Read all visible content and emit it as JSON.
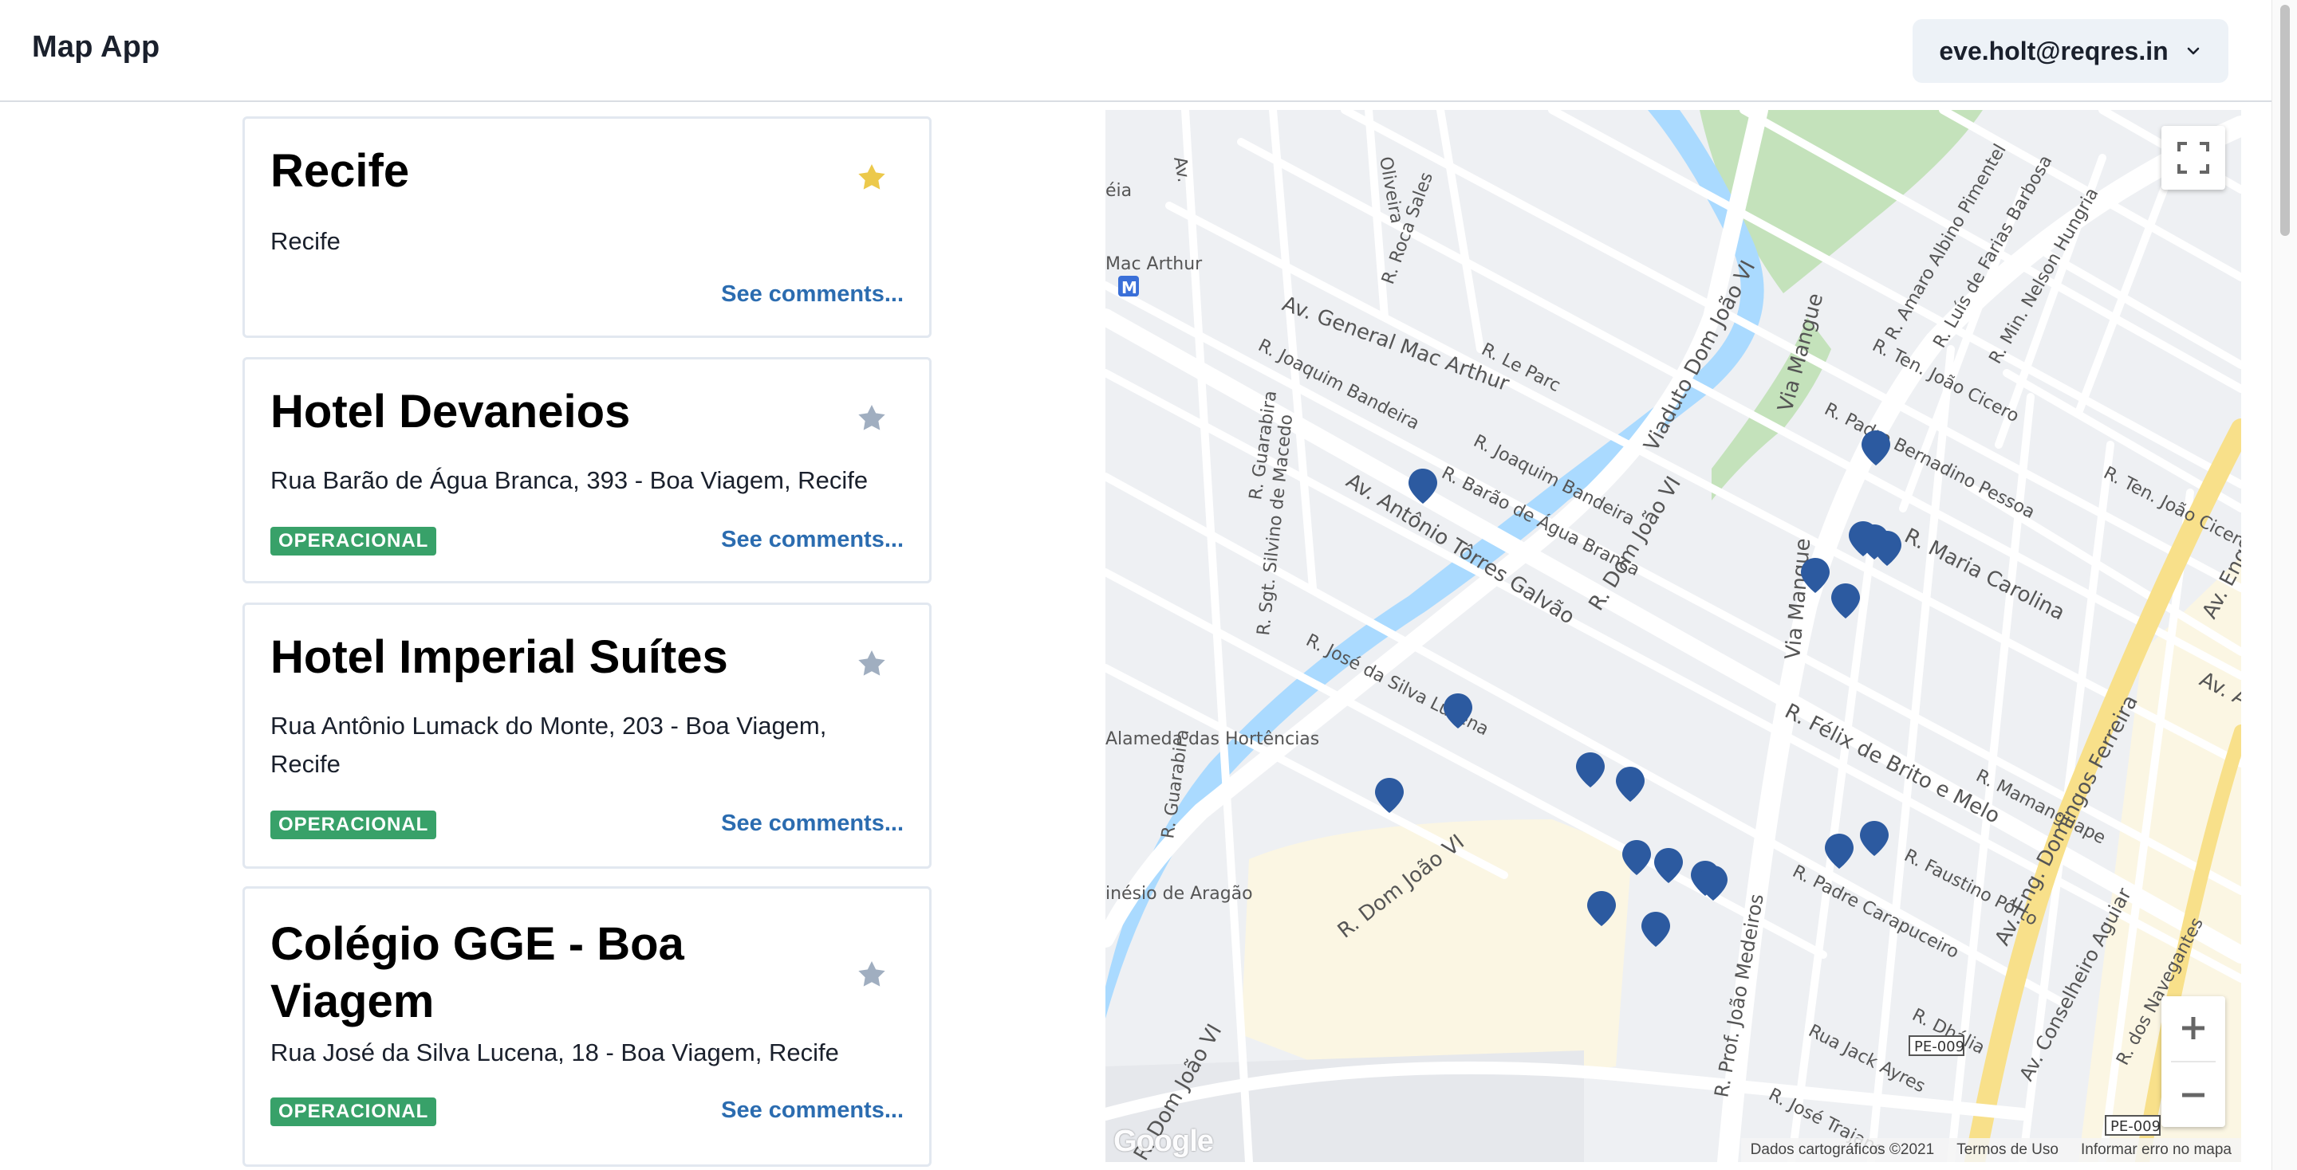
{
  "header": {
    "app_title": "Map App",
    "user_email": "eve.holt@reqres.in",
    "menu_icon": "chevron-down-icon"
  },
  "places": [
    {
      "name": "Recife",
      "address": "Recife",
      "status": "",
      "favorite": true,
      "comments_link": "See comments..."
    },
    {
      "name": "Hotel Devaneios",
      "address": "Rua Barão de Água Branca, 393 - Boa Viagem, Recife",
      "status": "OPERACIONAL",
      "favorite": false,
      "comments_link": "See comments..."
    },
    {
      "name": "Hotel Imperial Suítes",
      "address": "Rua Antônio Lumack do Monte, 203 - Boa Viagem, Recife",
      "status": "OPERACIONAL",
      "favorite": false,
      "comments_link": "See comments..."
    },
    {
      "name": "Colégio GGE - Boa Viagem",
      "address": "Rua José da Silva Lucena, 18 - Boa Viagem, Recife",
      "status": "OPERACIONAL",
      "favorite": false,
      "comments_link": "See comments..."
    }
  ],
  "colors": {
    "favorite_star": "#ECC94B",
    "inactive_star": "#A0AEC0",
    "status_badge": "#38A169",
    "link": "#2B6CB0",
    "map_pin": "#2C5AA0",
    "water": "#AADAFF",
    "park": "#C0DFB8",
    "major_road": "#F8E08A"
  },
  "map": {
    "street_labels": [
      "Mac Arthur",
      "Av. General Mac Arthur",
      "R. Joaquim Bandeira",
      "R. Joaquim Bandeira",
      "R. Barão de Água Branca",
      "Av. Antônio Tôrres Galvão",
      "R. Dom João VI",
      "R. Dom João VI",
      "R. Dom João VI",
      "Viaduto Dom João VI",
      "Via Mangue",
      "Via Mangue",
      "R. Maria Carolina",
      "R. Félix de Brito e Melo",
      "R. Padre Bernadino Pessoa",
      "R. Ten. João Cicero",
      "R. Ten. João Cicero",
      "R. Amaro Albino Pimentel",
      "R. Luís de Farias Barbosa",
      "R. Min. Nelson Hungria",
      "R. Mamanguape",
      "R. Faustino Pôrto",
      "R. Padre Carapuceiro",
      "R. Prof. João Medeiros",
      "R. Dhália",
      "Rua Jack Ayres",
      "R. José Trajano",
      "Av. Eng. Domingos Ferreira",
      "Av. Conselheiro Aguiar",
      "R. dos Navegantes",
      "R. José da Silva Lucena",
      "Alameda das Hortências",
      "R. Guarabira",
      "R. Guarabira",
      "R. Sgt. Silvino de Macedo",
      "R. Roca Sales",
      "R. Le Parc",
      "Av. Ant",
      "Av. Eng",
      "inésio de Aragão",
      "Oliveira",
      "éia",
      "Av.",
      "PE-009",
      "PE-009"
    ],
    "pin_count": 19,
    "google_logo": "Google",
    "attribution": {
      "data": "Dados cartográficos ©2021",
      "terms": "Termos de Uso",
      "report": "Informar erro no mapa"
    },
    "controls": {
      "fullscreen_icon": "fullscreen-icon",
      "zoom_in_icon": "plus-icon",
      "zoom_out_icon": "minus-icon"
    }
  }
}
